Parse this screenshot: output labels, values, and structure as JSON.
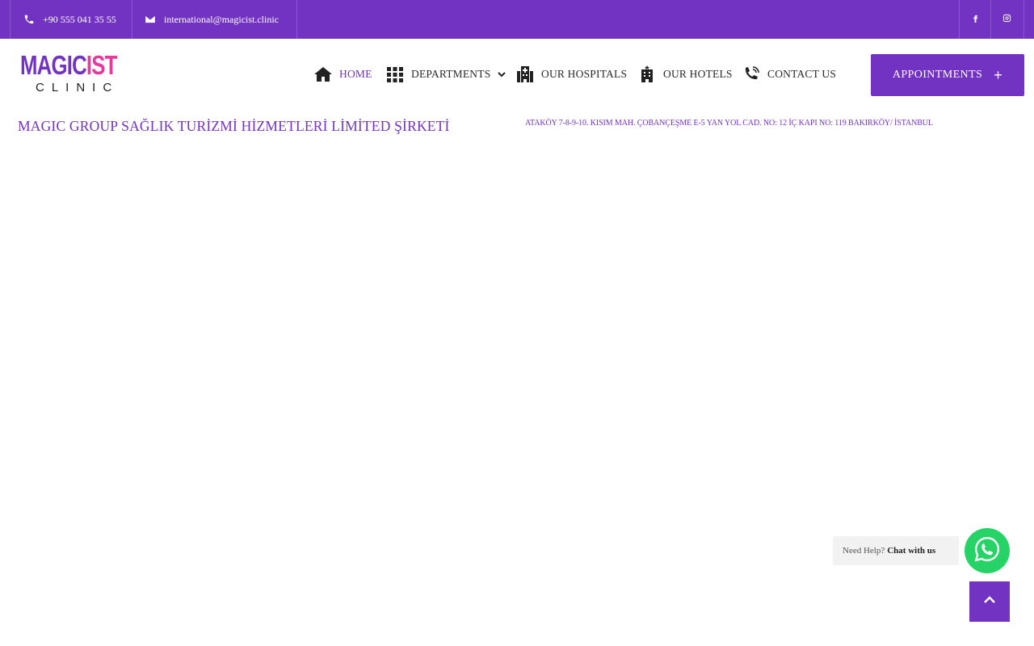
{
  "topbar": {
    "phone": "+90 555 041 35 55",
    "email": "international@magicist.clinic",
    "phone_icon": "phone-icon",
    "email_icon": "envelope-icon",
    "social": [
      "facebook-icon",
      "instagram-icon"
    ]
  },
  "logo": {
    "part1": "MAGIC",
    "part2": "IST",
    "sub": "CLINIC"
  },
  "nav": {
    "home": "HOME",
    "departments": "DEPARTMENTS",
    "hospitals": "OUR HOSPITALS",
    "hotels": "OUR HOTELS",
    "contact": "CONTACT US"
  },
  "appointments": {
    "label": "APPOINTMENTS",
    "plus": "+"
  },
  "company": {
    "name": "MAGIC GROUP SAĞLIK TURİZMİ HİZMETLERİ LİMİTED ŞİRKETİ",
    "address": "ATAKÖY 7-8-9-10. KISIM MAH. ÇOBANÇEŞME E-5 YAN YOL CAD. NO: 12 İÇ KAPI NO: 119 BAKIRKÖY/ İSTANBUL"
  },
  "whatsapp": {
    "need_help": "Need Help?",
    "chat": "Chat with us"
  },
  "colors": {
    "brand": "#7233c2",
    "accent": "#e6399b",
    "whatsapp": "#25d366"
  }
}
